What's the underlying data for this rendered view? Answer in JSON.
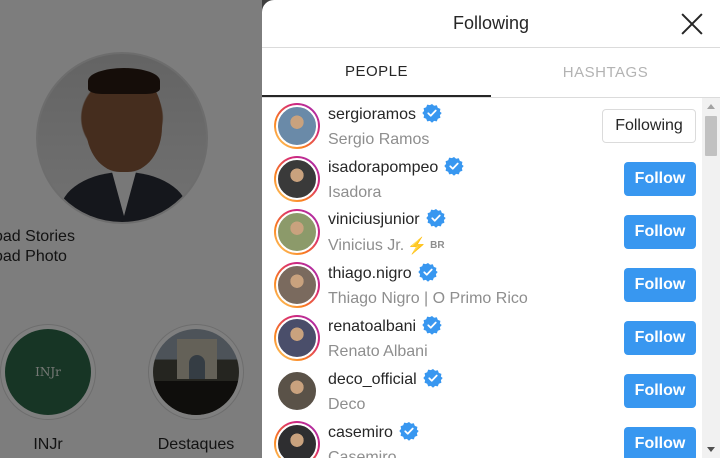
{
  "background": {
    "profile_link_1": "oad Stories",
    "profile_link_2": "oad Photo",
    "highlights": [
      {
        "label": "INJr",
        "logo_text": "INJr"
      },
      {
        "label": "Destaques"
      }
    ]
  },
  "modal": {
    "title": "Following",
    "tabs": [
      {
        "label": "PEOPLE",
        "active": true
      },
      {
        "label": "HASHTAGS",
        "active": false
      }
    ],
    "accounts": [
      {
        "username": "sergioramos",
        "name": "Sergio Ramos",
        "verified": true,
        "button": "Following",
        "state": "following",
        "avatar_color": "#6a8aa8"
      },
      {
        "username": "isadorapompeo",
        "name": "Isadora",
        "verified": true,
        "button": "Follow",
        "state": "follow",
        "avatar_color": "#3a3a3a"
      },
      {
        "username": "viniciusjunior",
        "name": "Vinicius Jr.",
        "name_badge": "BR",
        "verified": true,
        "button": "Follow",
        "state": "follow",
        "avatar_color": "#8c9a6a"
      },
      {
        "username": "thiago.nigro",
        "name": "Thiago Nigro | O Primo Rico",
        "verified": true,
        "button": "Follow",
        "state": "follow",
        "avatar_color": "#7a6a5e"
      },
      {
        "username": "renatoalbani",
        "name": "Renato Albani",
        "verified": true,
        "button": "Follow",
        "state": "follow",
        "avatar_color": "#4a4e6a"
      },
      {
        "username": "deco_official",
        "name": "Deco",
        "verified": true,
        "button": "Follow",
        "state": "follow",
        "avatar_color": "#5a5248"
      },
      {
        "username": "casemiro",
        "name": "Casemiro",
        "verified": true,
        "button": "Follow",
        "state": "follow",
        "avatar_color": "#2e2e30"
      }
    ]
  },
  "colors": {
    "follow_blue": "#3897f0",
    "verified_blue": "#3897f0",
    "story_ring": "#d62976"
  }
}
